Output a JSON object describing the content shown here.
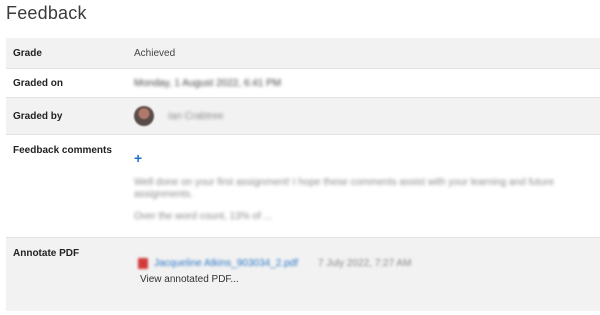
{
  "page": {
    "title": "Feedback"
  },
  "rows": {
    "grade": {
      "label": "Grade",
      "value": "Achieved"
    },
    "graded_on": {
      "label": "Graded on",
      "value": "Monday, 1 August 2022, 6:41 PM"
    },
    "graded_by": {
      "label": "Graded by",
      "value": "Ian Crabtree"
    },
    "feedback_comments": {
      "label": "Feedback comments",
      "add_icon": "+",
      "lines": [
        "Well done on your first assignment! I hope these comments assist with your learning and future assignments.",
        "Over the word count, 13% of ..."
      ]
    },
    "annotate_pdf": {
      "label": "Annotate PDF",
      "file_name": "Jacqueline Atkins_903034_2.pdf",
      "file_date": "7 July 2022, 7:27 AM",
      "view_link": "View annotated PDF..."
    }
  },
  "colors": {
    "row_shade": "#f2f2f2",
    "link": "#2d78c7",
    "add_icon": "#1f74c9",
    "pdf_icon": "#d33a3a"
  }
}
